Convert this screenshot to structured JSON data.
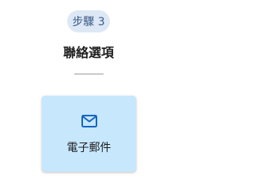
{
  "step": {
    "badge_label": "步驟 3"
  },
  "section": {
    "title": "聯絡選項"
  },
  "options": [
    {
      "label": "電子郵件",
      "icon": "mail-icon"
    }
  ],
  "colors": {
    "badge_bg": "#dde8f6",
    "badge_text": "#3a5a86",
    "card_bg": "#c7e7fd",
    "icon_color": "#1565c0"
  }
}
